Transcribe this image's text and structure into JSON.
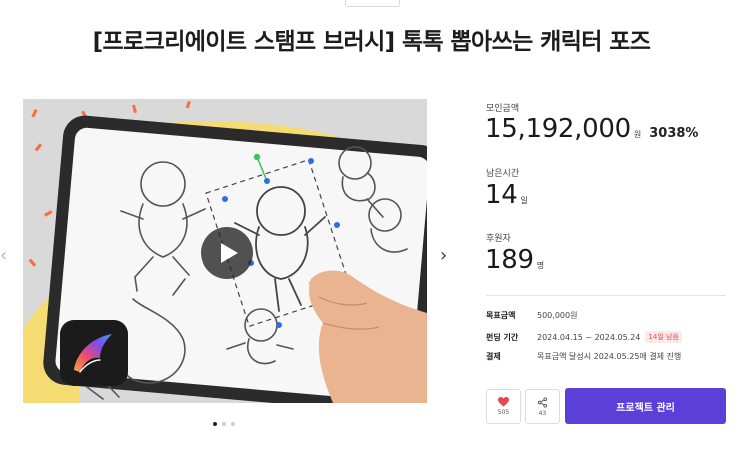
{
  "project": {
    "title": "[프로크리에이트 스탬프 브러시] 톡톡 뽑아쓰는 캐릭터 포즈"
  },
  "stats": {
    "funding_label": "모인금액",
    "funding_amount": "15,192,000",
    "funding_unit": "원",
    "funding_percent": "3038%",
    "remaining_label": "남은시간",
    "remaining_value": "14",
    "remaining_unit": "일",
    "backers_label": "후원자",
    "backers_value": "189",
    "backers_unit": "명"
  },
  "details": {
    "goal_label": "목표금액",
    "goal_value": "500,000원",
    "period_label": "펀딩 기간",
    "period_value": "2024.04.15 ~ 2024.05.24",
    "period_badge": "14일 남음",
    "payment_label": "결제",
    "payment_value": "목표금액 달성시 2024.05.25에 결제 진행"
  },
  "actions": {
    "like_count": "505",
    "share_count": "43",
    "manage_label": "프로젝트 관리"
  },
  "carousel": {
    "slide_count": 3,
    "active_index": 0
  },
  "colors": {
    "primary": "#5a3fd8",
    "like": "#e5484d",
    "badge_text": "#e5484d",
    "badge_bg": "#fde9ea"
  },
  "icons": {
    "prev": "chevron-left-icon",
    "next": "chevron-right-icon",
    "play": "play-icon",
    "like": "heart-icon",
    "share": "share-icon"
  }
}
